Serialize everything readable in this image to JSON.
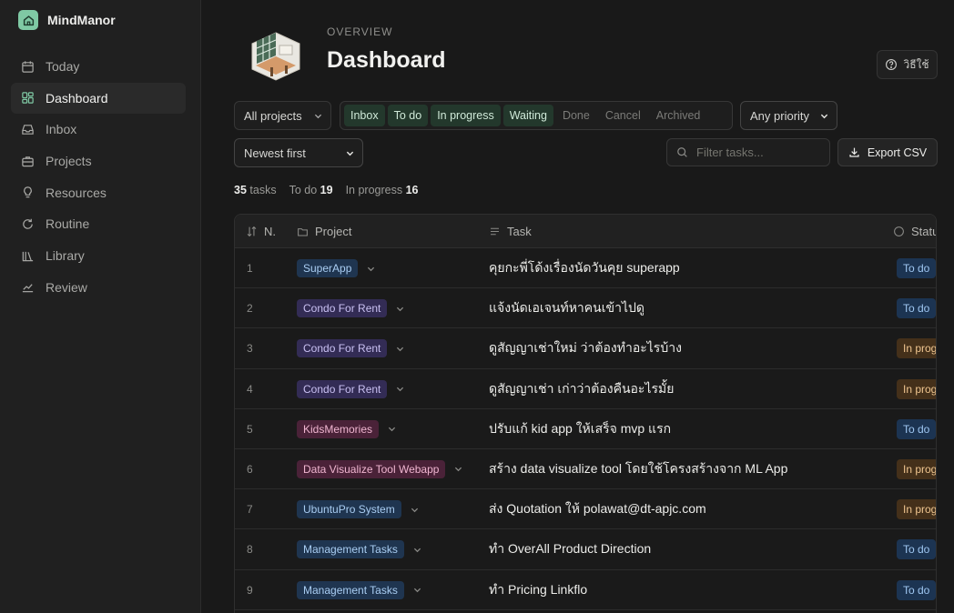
{
  "app": {
    "name": "MindManor"
  },
  "sidebar": {
    "items": [
      {
        "label": "Today",
        "icon": "calendar-icon"
      },
      {
        "label": "Dashboard",
        "icon": "dashboard-icon",
        "active": true
      },
      {
        "label": "Inbox",
        "icon": "inbox-icon"
      },
      {
        "label": "Projects",
        "icon": "briefcase-icon"
      },
      {
        "label": "Resources",
        "icon": "lightbulb-icon"
      },
      {
        "label": "Routine",
        "icon": "repeat-icon"
      },
      {
        "label": "Library",
        "icon": "books-icon"
      },
      {
        "label": "Review",
        "icon": "trend-icon"
      }
    ]
  },
  "header": {
    "overline": "OVERVIEW",
    "title": "Dashboard",
    "help_label": "วิธีใช้"
  },
  "filters": {
    "project": "All projects",
    "statuses": [
      {
        "label": "Inbox",
        "on": true
      },
      {
        "label": "To do",
        "on": true
      },
      {
        "label": "In progress",
        "on": true
      },
      {
        "label": "Waiting",
        "on": true
      },
      {
        "label": "Done",
        "on": false
      },
      {
        "label": "Cancel",
        "on": false
      },
      {
        "label": "Archived",
        "on": false
      }
    ],
    "priority": "Any priority",
    "sort": "Newest first",
    "search_placeholder": "Filter tasks...",
    "export_label": "Export CSV"
  },
  "counts": {
    "tasks_value": "35",
    "tasks_label": "tasks",
    "todo_label": "To do",
    "todo_value": "19",
    "inprogress_label": "In progress",
    "inprogress_value": "16"
  },
  "table": {
    "columns": {
      "number": "N.",
      "project": "Project",
      "task": "Task",
      "status": "Status"
    },
    "rows": [
      {
        "n": "1",
        "project": "SuperApp",
        "task": "คุยกะพี่โด้งเรื่องนัดวันคุย superapp",
        "status": "To do"
      },
      {
        "n": "2",
        "project": "Condo For Rent",
        "task": "แจ้งนัดเอเจนท์หาคนเข้าไปดู",
        "status": "To do"
      },
      {
        "n": "3",
        "project": "Condo For Rent",
        "task": "ดูสัญญาเช่าใหม่ ว่าต้องทำอะไรบ้าง",
        "status": "In progress"
      },
      {
        "n": "4",
        "project": "Condo For Rent",
        "task": "ดูสัญญาเช่า เก่าว่าต้องคืนอะไรมั้ย",
        "status": "In progress"
      },
      {
        "n": "5",
        "project": "KidsMemories",
        "task": "ปรับแก้ kid app ให้เสร็จ mvp แรก",
        "status": "To do"
      },
      {
        "n": "6",
        "project": "Data Visualize Tool Webapp",
        "task": "สร้าง data visualize tool โดยใช้โครงสร้างจาก ML App",
        "status": "In progress"
      },
      {
        "n": "7",
        "project": "UbuntuPro System",
        "task": "ส่ง Quotation ให้ polawat@dt-apjc.com",
        "status": "In progress"
      },
      {
        "n": "8",
        "project": "Management Tasks",
        "task": "ทำ OverAll Product Direction",
        "status": "To do"
      },
      {
        "n": "9",
        "project": "Management Tasks",
        "task": "ทำ Pricing Linkflo",
        "status": "To do"
      }
    ]
  },
  "colors": {
    "SuperApp": {
      "bg": "#1f3550",
      "fg": "#a9cdf2"
    },
    "Condo For Rent": {
      "bg": "#332c55",
      "fg": "#c9c0f2"
    },
    "KidsMemories": {
      "bg": "#4a2238",
      "fg": "#f0b6d1"
    },
    "Data Visualize Tool Webapp": {
      "bg": "#4a2238",
      "fg": "#f0b6d1"
    },
    "UbuntuPro System": {
      "bg": "#1f3550",
      "fg": "#a9cdf2"
    },
    "Management Tasks": {
      "bg": "#1f3550",
      "fg": "#a9cdf2"
    },
    "To do": {
      "bg": "#1c3452",
      "fg": "#9fc7f2"
    },
    "In progress": {
      "bg": "#44301a",
      "fg": "#efc58f"
    }
  }
}
